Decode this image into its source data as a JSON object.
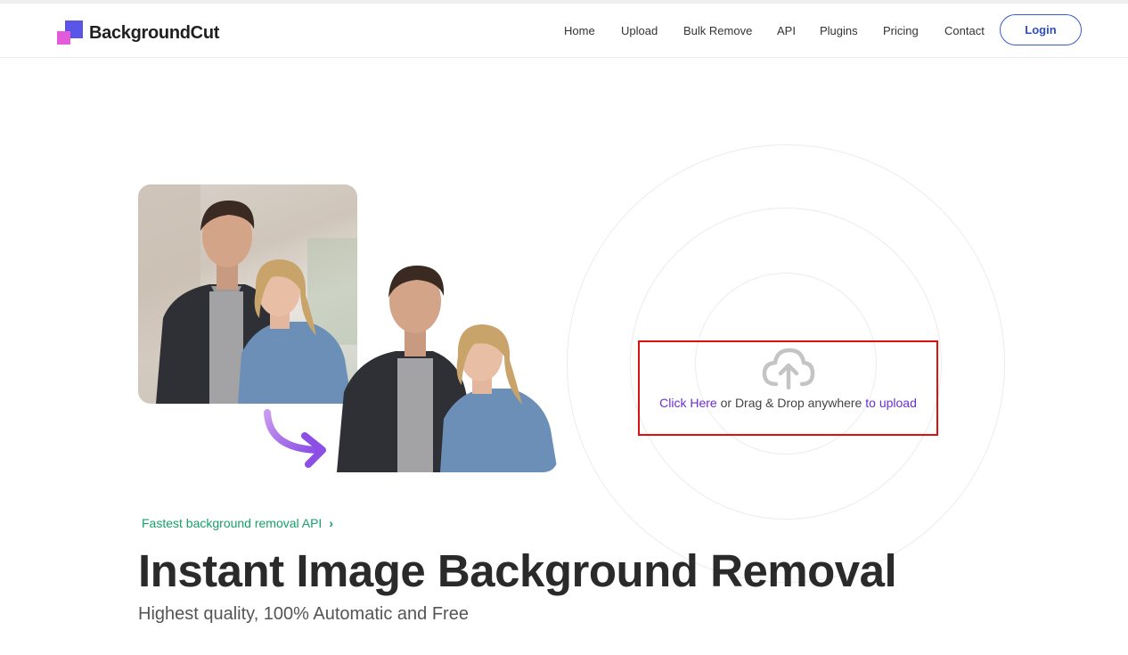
{
  "brand": {
    "name": "BackgroundCut",
    "mark_colors": [
      "#5a55e6",
      "#e35bd9"
    ]
  },
  "nav": {
    "items": [
      {
        "label": "Home"
      },
      {
        "label": "Upload"
      },
      {
        "label": "Bulk Remove"
      },
      {
        "label": "API"
      },
      {
        "label": "Plugins"
      },
      {
        "label": "Pricing"
      },
      {
        "label": "Contact"
      }
    ],
    "login_label": "Login"
  },
  "upload": {
    "icon": "cloud-upload-icon",
    "click_label": "Click Here",
    "middle_text": " or Drag & Drop anywhere ",
    "tail_label": "to upload"
  },
  "hero": {
    "tagline": "Fastest background removal API",
    "tagline_icon": "chevron-right-icon",
    "title": "Instant Image Background Removal",
    "subtitle": "Highest quality, 100% Automatic and Free"
  },
  "colors": {
    "accent_purple": "#6a2fd4",
    "accent_green": "#17a06a",
    "login_blue": "#2f4fc4",
    "highlight_red": "#dd1111"
  }
}
